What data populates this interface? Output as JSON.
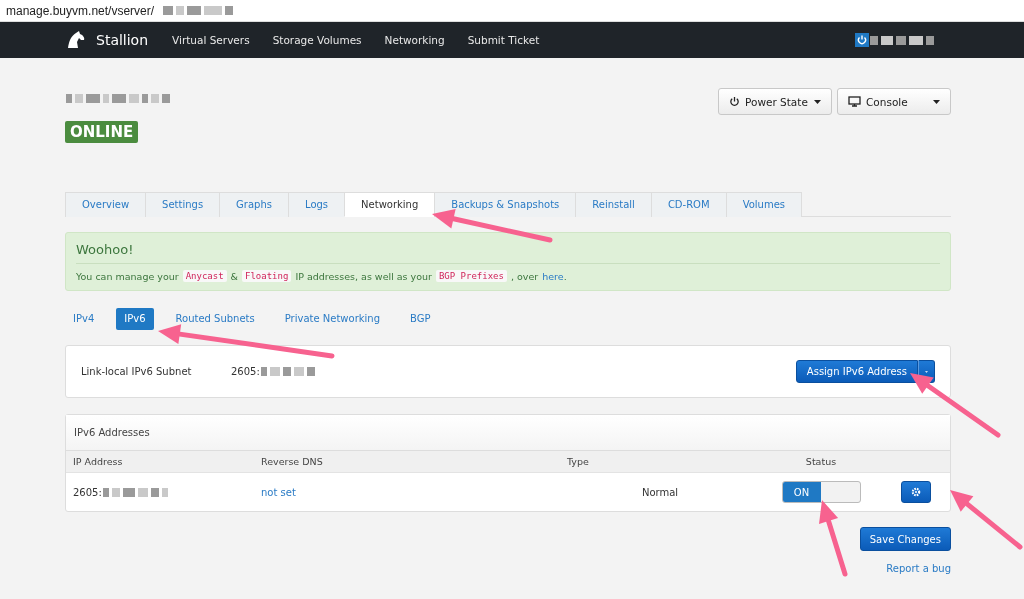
{
  "browser": {
    "url": "manage.buyvm.net/vserver/"
  },
  "nav": {
    "brand": "Stallion",
    "links": [
      "Virtual Servers",
      "Storage Volumes",
      "Networking",
      "Submit Ticket"
    ]
  },
  "server": {
    "status": "ONLINE"
  },
  "actions": [
    {
      "kind": "power",
      "label": "Power State"
    },
    {
      "kind": "console",
      "label": "Console"
    }
  ],
  "tabs": [
    {
      "label": "Overview",
      "selected": false
    },
    {
      "label": "Settings",
      "selected": false
    },
    {
      "label": "Graphs",
      "selected": false
    },
    {
      "label": "Logs",
      "selected": false
    },
    {
      "label": "Networking",
      "selected": true
    },
    {
      "label": "Backups & Snapshots",
      "selected": false
    },
    {
      "label": "Reinstall",
      "selected": false
    },
    {
      "label": "CD-ROM",
      "selected": false
    },
    {
      "label": "Volumes",
      "selected": false
    }
  ],
  "alert": {
    "title": "Woohoo!",
    "parts": [
      {
        "kind": "text",
        "text": "You can manage your"
      },
      {
        "kind": "code",
        "text": "Anycast"
      },
      {
        "kind": "text",
        "text": "&"
      },
      {
        "kind": "code",
        "text": "Floating"
      },
      {
        "kind": "text",
        "text": "IP addresses, as well as your"
      },
      {
        "kind": "code",
        "text": "BGP Prefixes"
      },
      {
        "kind": "text",
        "text": ", over"
      },
      {
        "kind": "link",
        "text": "here"
      },
      {
        "kind": "text",
        "text": "."
      }
    ]
  },
  "subtabs": [
    {
      "label": "IPv4",
      "selected": false
    },
    {
      "label": "IPv6",
      "selected": true
    },
    {
      "label": "Routed Subnets",
      "selected": false
    },
    {
      "label": "Private Networking",
      "selected": false
    },
    {
      "label": "BGP",
      "selected": false
    }
  ],
  "subnet": {
    "label": "Link-local IPv6 Subnet",
    "value": "2605:",
    "button": "Assign IPv6 Address"
  },
  "table": {
    "title": "IPv6 Addresses",
    "columns": [
      "IP Address",
      "Reverse DNS",
      "Type",
      "Status"
    ],
    "rows": [
      {
        "ip": "2605:",
        "rdns": "not set",
        "type": "Normal",
        "status": {
          "on": true,
          "label": "ON"
        }
      }
    ]
  },
  "save": "Save Changes",
  "report": "Report a bug"
}
